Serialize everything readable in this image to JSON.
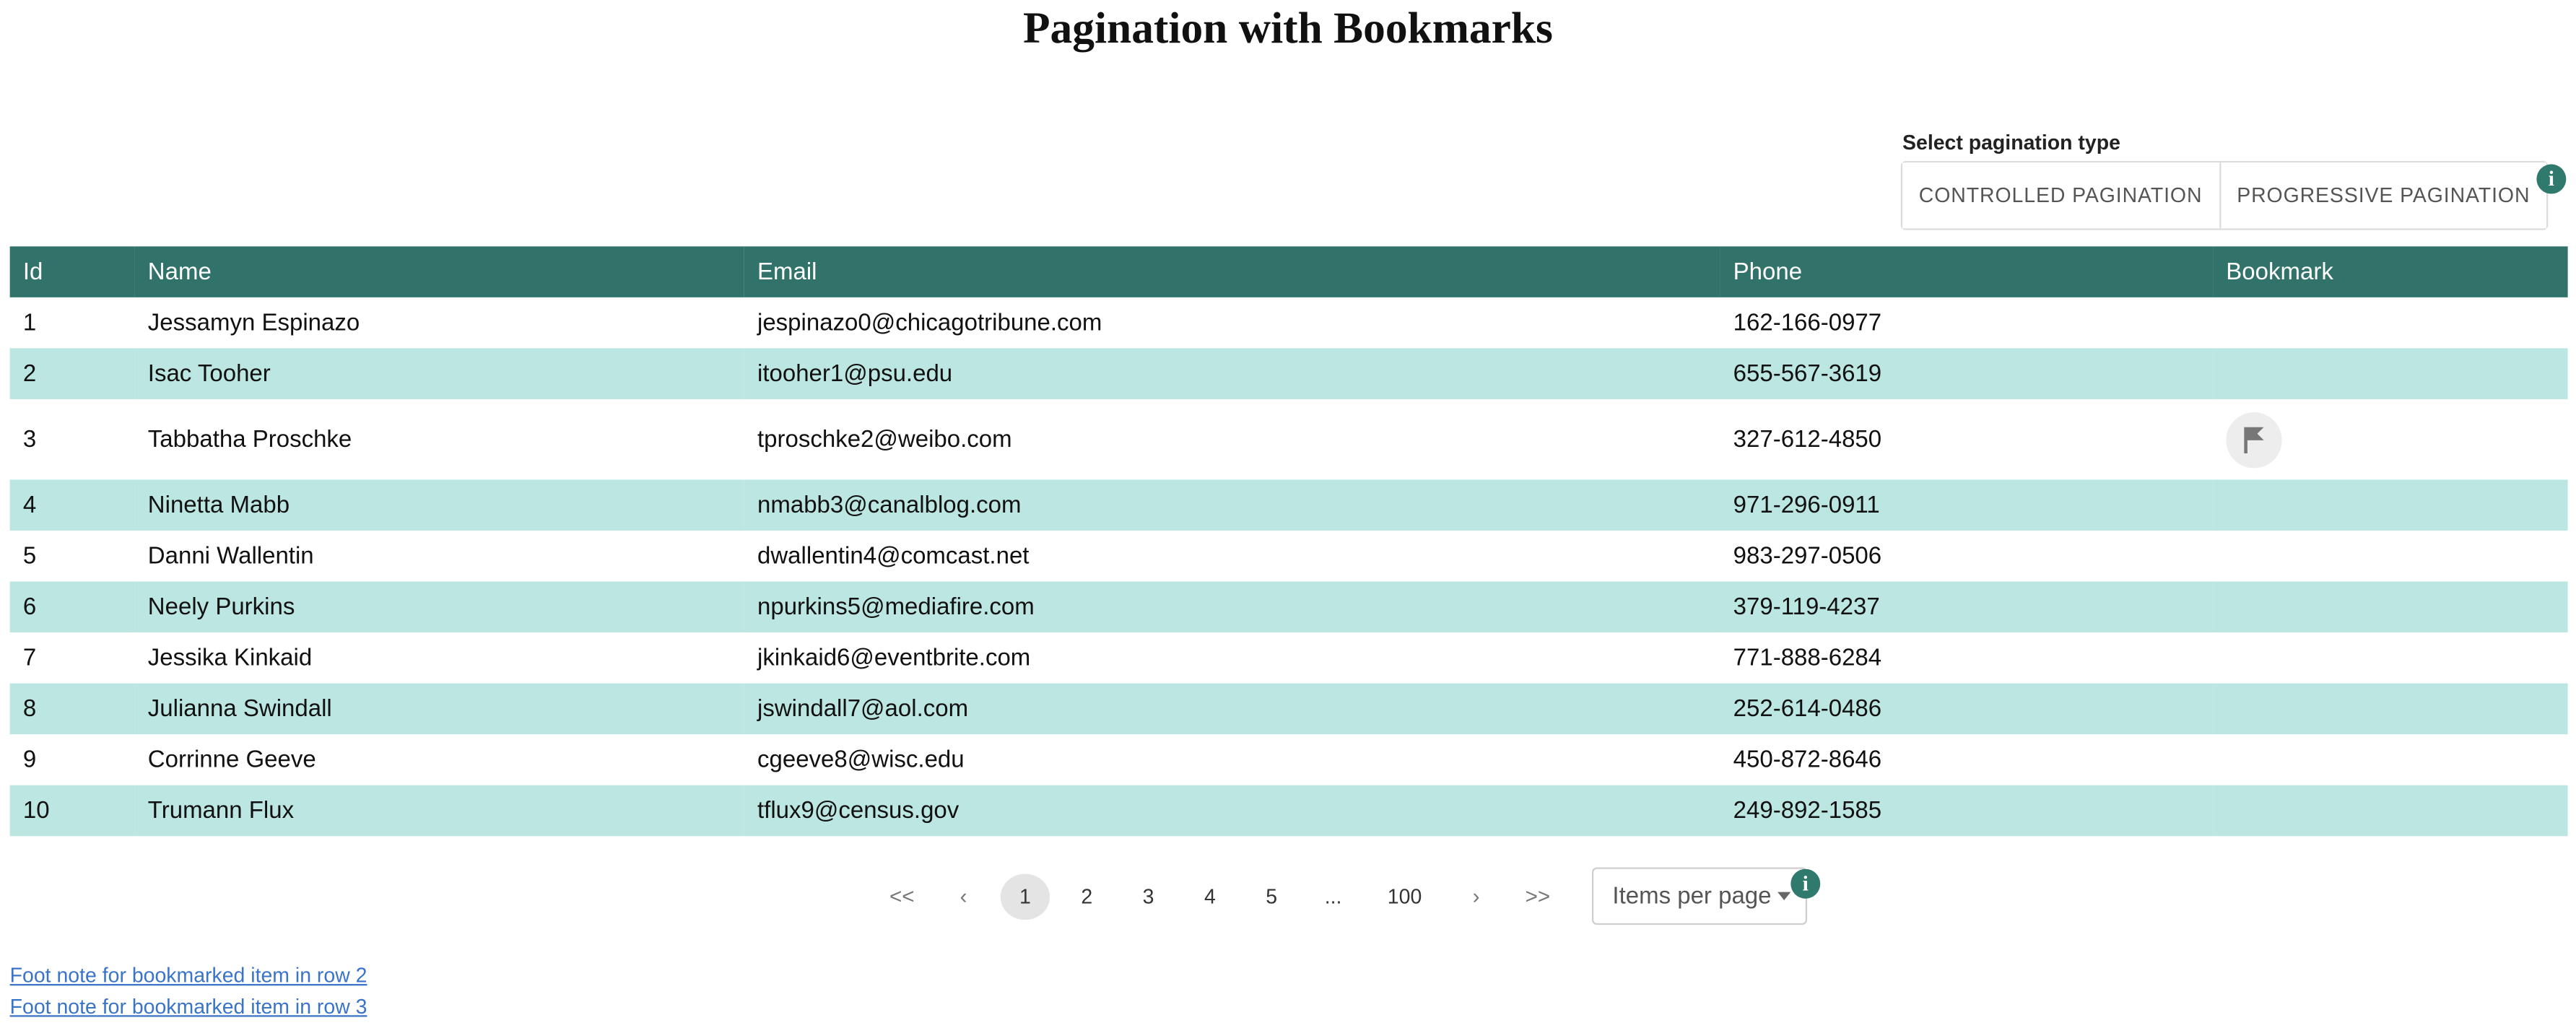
{
  "page": {
    "title": "Pagination with Bookmarks"
  },
  "pagination_type": {
    "label": "Select pagination type",
    "options": [
      "CONTROLLED PAGINATION",
      "PROGRESSIVE PAGINATION"
    ],
    "info_icon": "info-icon"
  },
  "table": {
    "columns": [
      "Id",
      "Name",
      "Email",
      "Phone",
      "Bookmark"
    ],
    "rows": [
      {
        "id": "1",
        "name": "Jessamyn Espinazo",
        "email": "jespinazo0@chicagotribune.com",
        "phone": "162-166-0977",
        "bookmarked": false
      },
      {
        "id": "2",
        "name": "Isac Tooher",
        "email": "itooher1@psu.edu",
        "phone": "655-567-3619",
        "bookmarked": false
      },
      {
        "id": "3",
        "name": "Tabbatha Proschke",
        "email": "tproschke2@weibo.com",
        "phone": "327-612-4850",
        "bookmarked": true
      },
      {
        "id": "4",
        "name": "Ninetta Mabb",
        "email": "nmabb3@canalblog.com",
        "phone": "971-296-0911",
        "bookmarked": false
      },
      {
        "id": "5",
        "name": "Danni Wallentin",
        "email": "dwallentin4@comcast.net",
        "phone": "983-297-0506",
        "bookmarked": false
      },
      {
        "id": "6",
        "name": "Neely Purkins",
        "email": "npurkins5@mediafire.com",
        "phone": "379-119-4237",
        "bookmarked": false
      },
      {
        "id": "7",
        "name": "Jessika Kinkaid",
        "email": "jkinkaid6@eventbrite.com",
        "phone": "771-888-6284",
        "bookmarked": false
      },
      {
        "id": "8",
        "name": "Julianna Swindall",
        "email": "jswindall7@aol.com",
        "phone": "252-614-0486",
        "bookmarked": false
      },
      {
        "id": "9",
        "name": "Corrinne Geeve",
        "email": "cgeeve8@wisc.edu",
        "phone": "450-872-8646",
        "bookmarked": false
      },
      {
        "id": "10",
        "name": "Trumann Flux",
        "email": "tflux9@census.gov",
        "phone": "249-892-1585",
        "bookmarked": false
      }
    ],
    "bookmark_icon": "bookmark-flag-icon"
  },
  "pager": {
    "first": "<<",
    "prev": "‹",
    "pages": [
      "1",
      "2",
      "3",
      "4",
      "5"
    ],
    "current_page": "1",
    "ellipsis": "...",
    "last_page": "100",
    "next": "›",
    "last": ">>",
    "items_per_page": "Items per page",
    "info_icon": "info-icon"
  },
  "footnotes": [
    "Foot note for bookmarked item in row 2",
    "Foot note for bookmarked item in row 3"
  ],
  "colors": {
    "header_bg": "#31726a",
    "stripe_bg": "#bce6e1",
    "info_icon_bg": "#2f7a6d",
    "link": "#3a74c9"
  }
}
